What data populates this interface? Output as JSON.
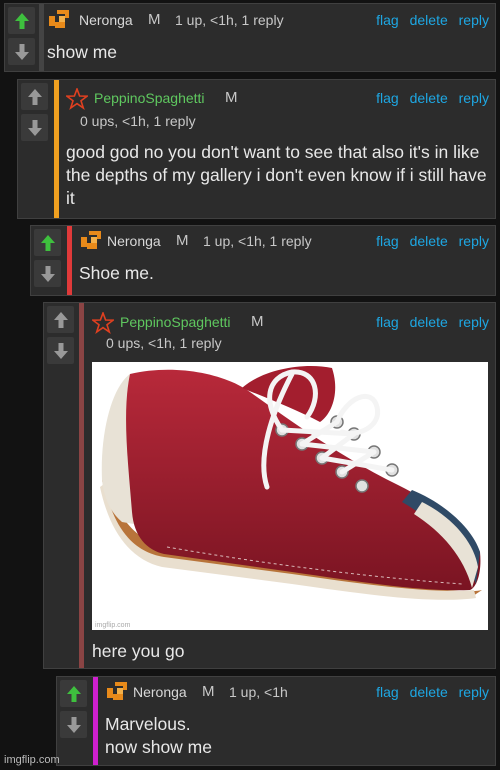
{
  "comments": [
    {
      "username": "Neronga",
      "mod": "M",
      "stats": "1 up, <1h, 1 reply",
      "text": "show me",
      "upvoted": true
    },
    {
      "username": "PeppinoSpaghetti",
      "mod": "M",
      "stats": "0 ups, <1h, 1 reply",
      "text": "good god no you don't want to see that also it's in like the depths of my gallery i don't even know if i still have it",
      "upvoted": false
    },
    {
      "username": "Neronga",
      "mod": "M",
      "stats": "1 up, <1h, 1 reply",
      "text": "Shoe me.",
      "upvoted": true
    },
    {
      "username": "PeppinoSpaghetti",
      "mod": "M",
      "stats": "0 ups, <1h, 1 reply",
      "text": "here you go",
      "upvoted": false,
      "image_watermark": "imgflip.com"
    },
    {
      "username": "Neronga",
      "mod": "M",
      "stats": "1 up, <1h",
      "text": "Marvelous.\nnow show me",
      "upvoted": true
    }
  ],
  "actions": {
    "flag": "flag",
    "delete": "delete",
    "reply": "reply"
  },
  "colors": {
    "bar_orange": "#f0a020",
    "bar_red": "#e03a3a",
    "bar_maroon": "#8a4444",
    "bar_magenta": "#d020d0",
    "link": "#1ea7e3",
    "username_green": "#5fc85f",
    "up_green": "#3ec03e"
  },
  "site_watermark": "imgflip.com"
}
